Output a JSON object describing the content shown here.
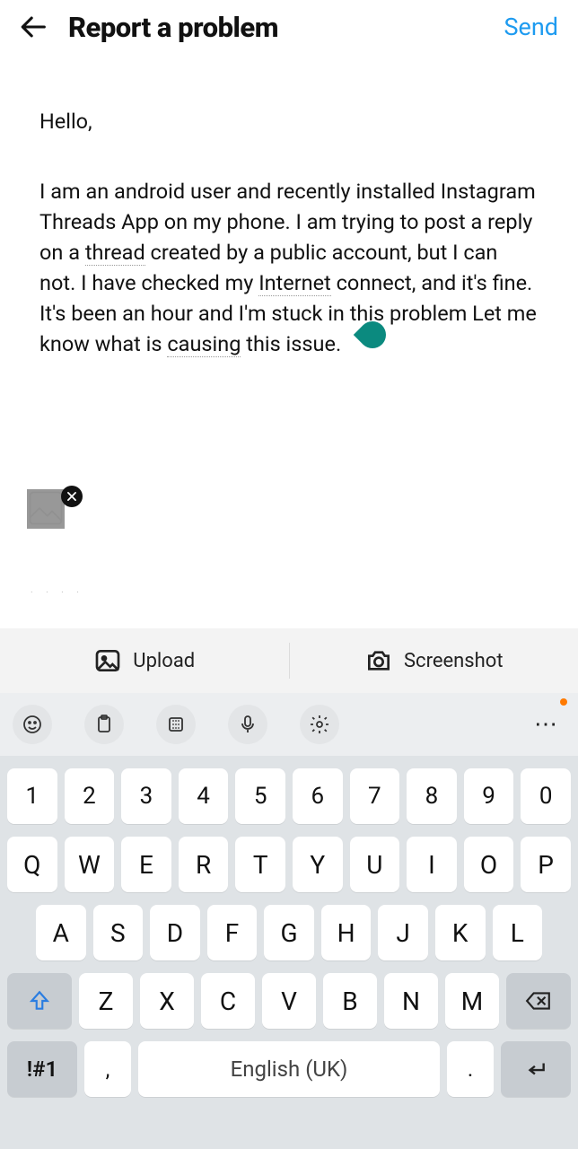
{
  "header": {
    "title": "Report a problem",
    "send_label": "Send"
  },
  "body": {
    "greeting": "Hello,",
    "paragraph_parts": [
      "I am an android user and recently installed Instagram Threads App on my phone. I am trying to post a reply on a ",
      "thread",
      " created by a public account, but I can not. I have checked my ",
      "Internet",
      " connect, and it's fine. It's  been an hour and I'm stuck in this problem Let me know what is ",
      "causing",
      " this issue."
    ],
    "caret_color": "#0b8a7f"
  },
  "attachment": {
    "has_thumbnail": true,
    "remove_icon": "close-icon"
  },
  "actionbar": {
    "upload_label": "Upload",
    "screenshot_label": "Screenshot"
  },
  "keyboard_strip": {
    "icons": [
      "emoji-icon",
      "clipboard-icon",
      "grid-icon",
      "microphone-icon",
      "settings-icon"
    ],
    "more": "⋯",
    "notification": true
  },
  "keyboard": {
    "row_numbers": [
      "1",
      "2",
      "3",
      "4",
      "5",
      "6",
      "7",
      "8",
      "9",
      "0"
    ],
    "row_top": [
      "Q",
      "W",
      "E",
      "R",
      "T",
      "Y",
      "U",
      "I",
      "O",
      "P"
    ],
    "row_mid": [
      "A",
      "S",
      "D",
      "F",
      "G",
      "H",
      "J",
      "K",
      "L"
    ],
    "row_bot": [
      "Z",
      "X",
      "C",
      "V",
      "B",
      "N",
      "M"
    ],
    "sym_label": "!#1",
    "comma": ",",
    "space_label": "English (UK)",
    "period": "."
  }
}
